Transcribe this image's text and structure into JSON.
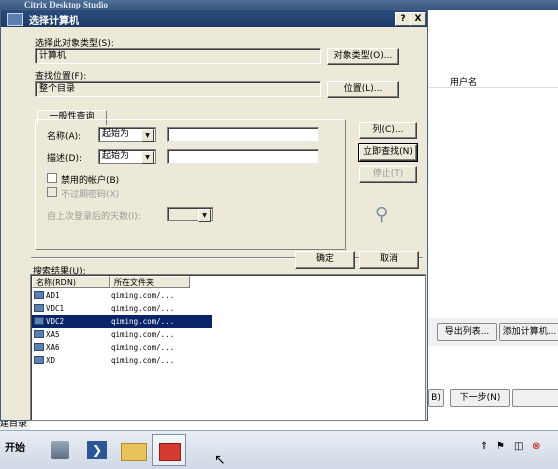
{
  "background_app": {
    "title": "Citrix Desktop Studio",
    "left_partial": "文",
    "username_col": "用户名",
    "export_btn": "导出列表...",
    "add_computer_btn": "添加计算机...",
    "back_btn": "B)",
    "next_btn": "下一步(N)",
    "status_partial": "建目录"
  },
  "taskbar": {
    "start_label": "开始"
  },
  "dialog": {
    "title": "选择计算机",
    "help_btn": "?",
    "close_btn": "X",
    "object_type_label": "选择此对象类型(S):",
    "object_type_value": "计算机",
    "object_type_btn": "对象类型(O)...",
    "location_label": "查找位置(F):",
    "location_value": "整个目录",
    "location_btn": "位置(L)...",
    "tab_label": "一般性查询",
    "name_label": "名称(A):",
    "name_op": "起始为",
    "desc_label": "描述(D):",
    "desc_op": "起始为",
    "disabled_accounts": "禁用的帐户(B)",
    "non_expiring_pw": "不过期密码(X)",
    "days_since_login": "自上次登录后的天数(I):",
    "columns_btn": "列(C)...",
    "find_now_btn": "立即查找(N)",
    "stop_btn": "停止(T)",
    "ok_btn": "确定",
    "cancel_btn": "取消",
    "results_label": "搜索结果(U):",
    "results_columns": [
      "名称(RDN)",
      "所在文件夹"
    ],
    "results": [
      {
        "name": "AD1",
        "folder": "qiming.com/..."
      },
      {
        "name": "VDC1",
        "folder": "qiming.com/..."
      },
      {
        "name": "VDC2",
        "folder": "qiming.com/...",
        "selected": true
      },
      {
        "name": "XA5",
        "folder": "qiming.com/..."
      },
      {
        "name": "XA6",
        "folder": "qiming.com/..."
      },
      {
        "name": "XD",
        "folder": "qiming.com/..."
      }
    ]
  },
  "colors": {
    "dialog_face": "#ece9d8",
    "title_bar": "#1c3a66",
    "selection": "#0a246a"
  }
}
